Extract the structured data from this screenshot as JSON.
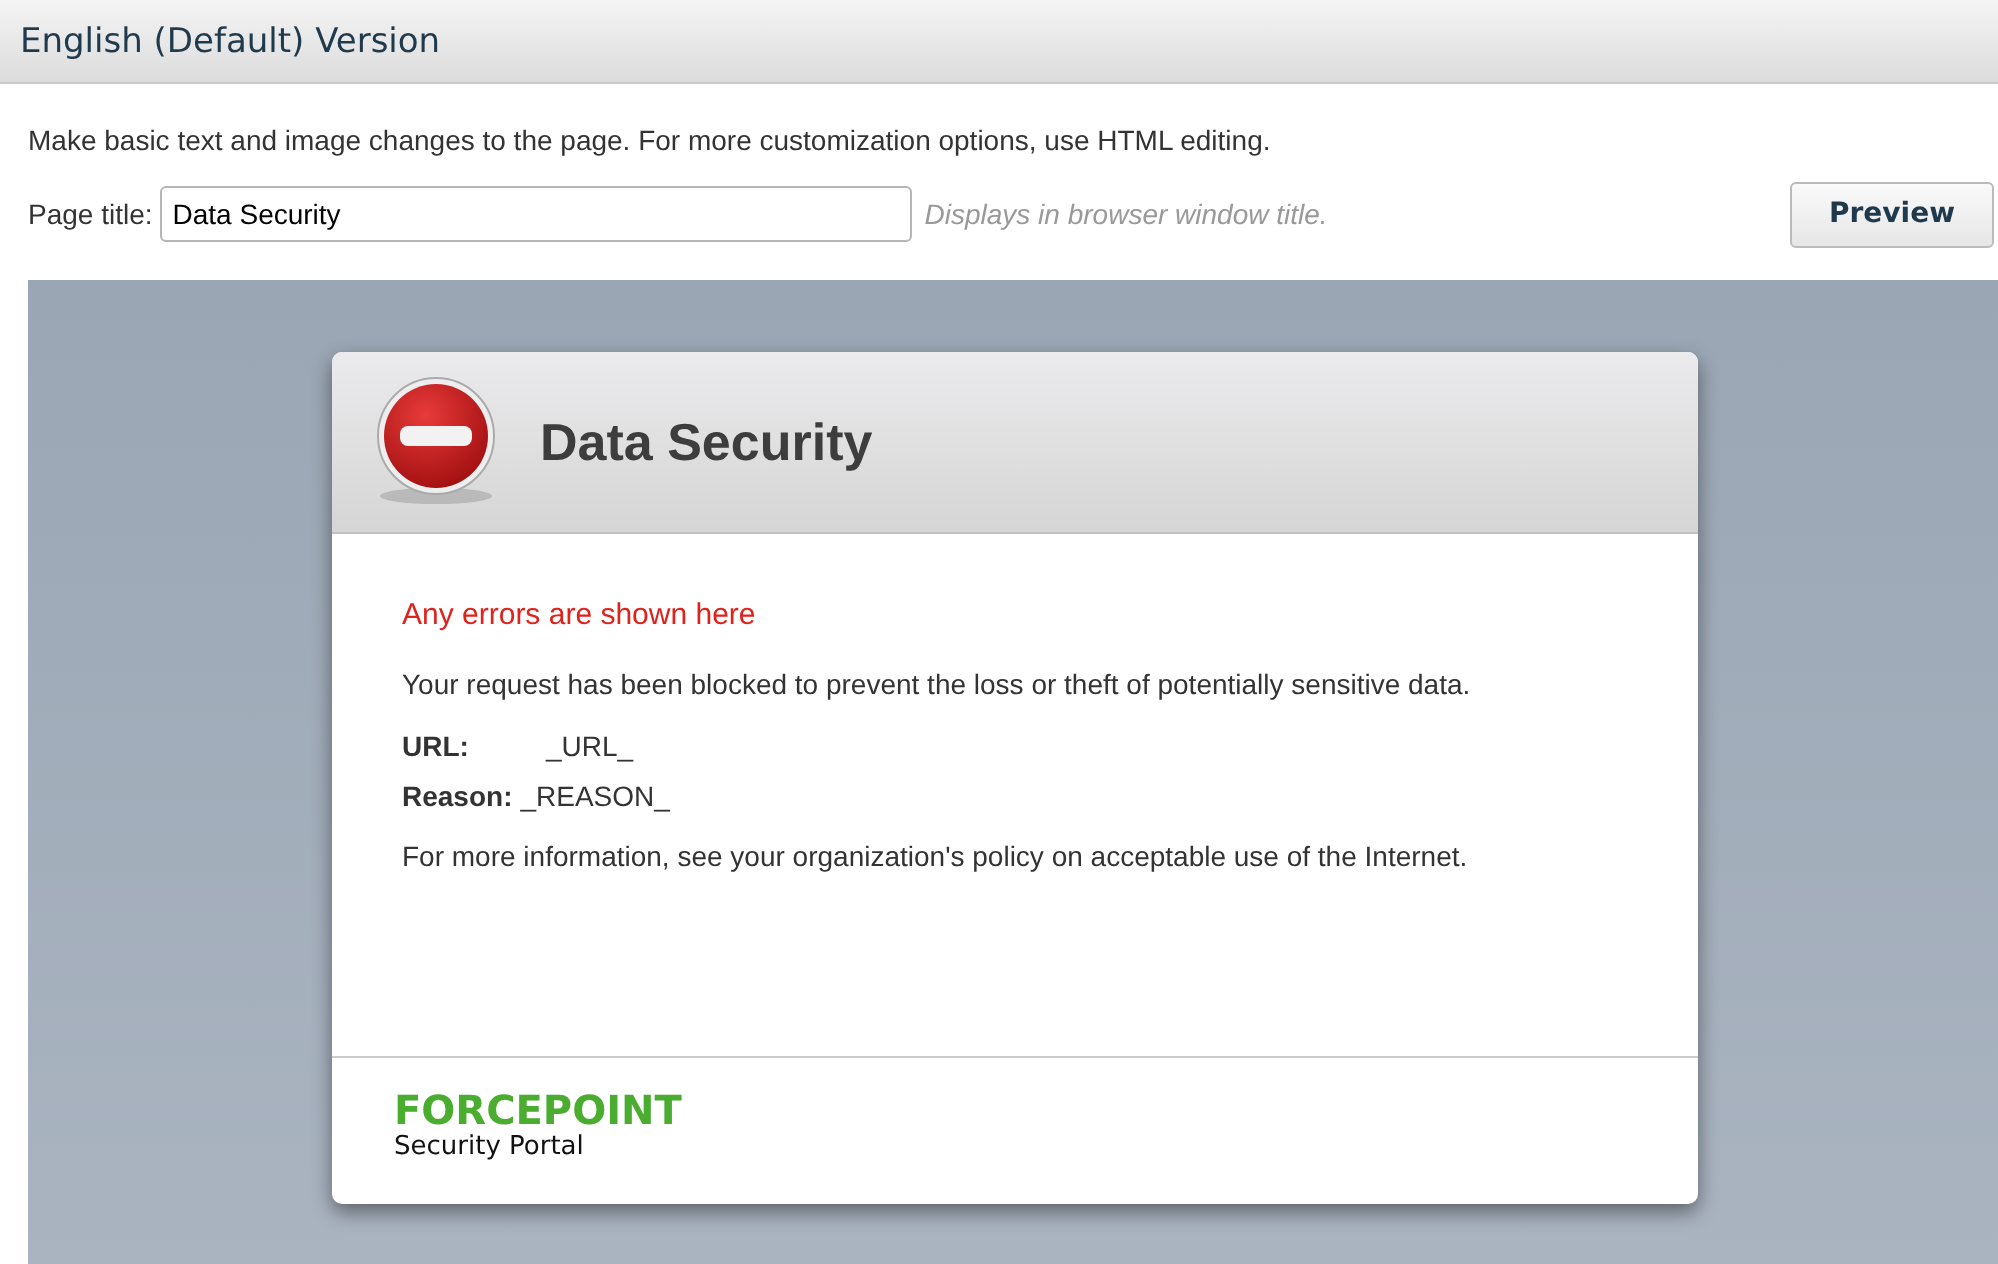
{
  "header": {
    "title": "English (Default) Version"
  },
  "description": "Make basic text and image changes to the page. For more customization options, use HTML editing.",
  "page_title_field": {
    "label": "Page title:",
    "value": "Data Security",
    "hint": "Displays in browser window title."
  },
  "preview_button": "Preview",
  "preview": {
    "title": "Data Security",
    "error": "Any errors are shown here",
    "message": "Your request has been blocked to prevent the loss or theft of potentially sensitive data.",
    "details": [
      {
        "label": "URL:",
        "value": "_URL_"
      },
      {
        "label": "Reason:",
        "value": "_REASON_"
      }
    ],
    "info": "For more information, see your organization's policy on acceptable use of the Internet.",
    "brand": "FORCEPOINT",
    "brand_subtitle": "Security Portal"
  }
}
